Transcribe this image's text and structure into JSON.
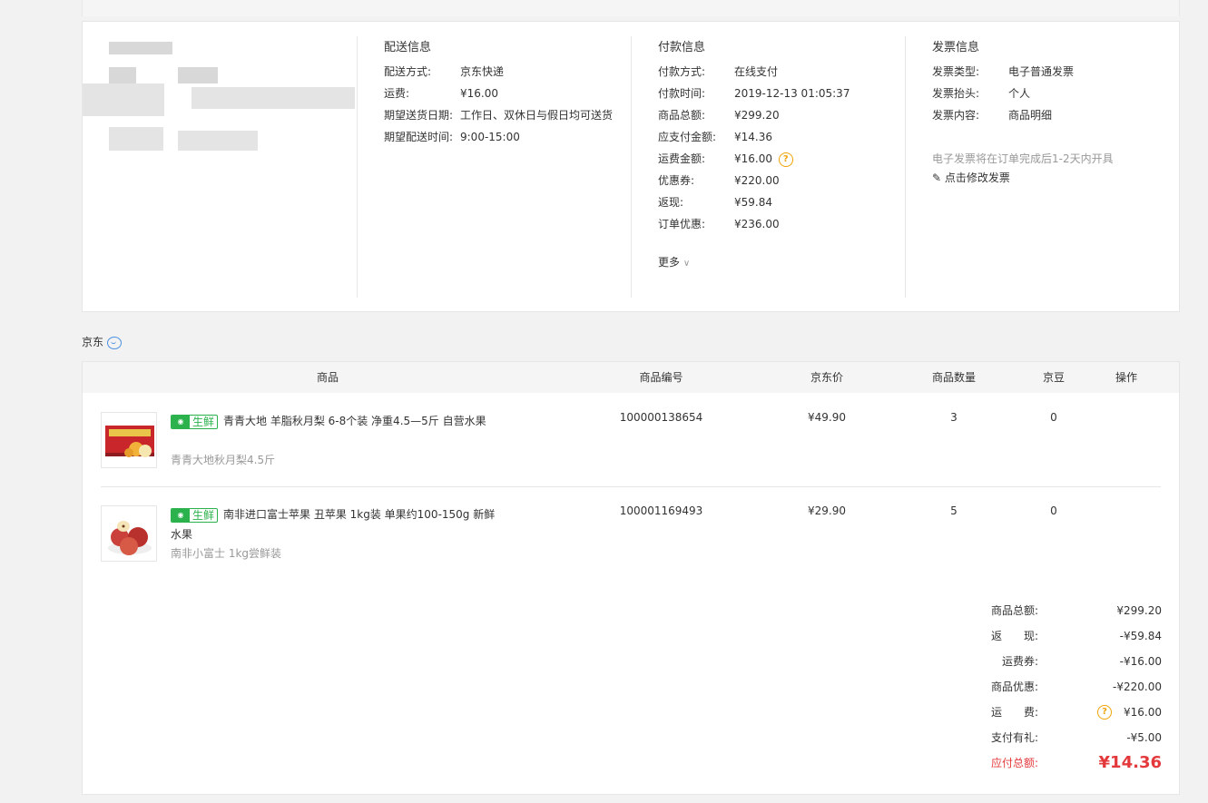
{
  "delivery": {
    "title": "配送信息",
    "rows": [
      {
        "k": "配送方式:",
        "v": "京东快递"
      },
      {
        "k": "运费:",
        "v": "¥16.00"
      },
      {
        "k": "期望送货日期:",
        "v": "工作日、双休日与假日均可送货"
      },
      {
        "k": "期望配送时间:",
        "v": "9:00-15:00"
      }
    ]
  },
  "payment": {
    "title": "付款信息",
    "rows": [
      {
        "k": "付款方式:",
        "v": "在线支付"
      },
      {
        "k": "付款时间:",
        "v": "2019-12-13 01:05:37"
      },
      {
        "k": "商品总额:",
        "v": "¥299.20"
      },
      {
        "k": "应支付金额:",
        "v": "¥14.36"
      },
      {
        "k": "运费金额:",
        "v": "¥16.00"
      },
      {
        "k": "优惠券:",
        "v": "¥220.00"
      },
      {
        "k": "返现:",
        "v": "¥59.84"
      },
      {
        "k": "订单优惠:",
        "v": "¥236.00"
      }
    ],
    "more_label": "更多",
    "help_glyph": "?"
  },
  "invoice": {
    "title": "发票信息",
    "rows": [
      {
        "k": "发票类型:",
        "v": "电子普通发票"
      },
      {
        "k": "发票抬头:",
        "v": "个人"
      },
      {
        "k": "发票内容:",
        "v": "商品明细"
      }
    ],
    "note": "电子发票将在订单完成后1-2天内开具",
    "edit_label": "点击修改发票",
    "edit_icon": "✎"
  },
  "shop": {
    "name": "京东",
    "chat_icon": "chat-bubble-icon"
  },
  "table": {
    "headers": [
      "商品",
      "商品编号",
      "京东价",
      "商品数量",
      "京豆",
      "操作"
    ],
    "fresh_tag_icon": "fresh-icon",
    "fresh_tag_label": "生鲜",
    "products": [
      {
        "name": "青青大地 羊脂秋月梨 6-8个装 净重4.5—5斤 自营水果",
        "sub": "青青大地秋月梨4.5斤",
        "sku": "100000138654",
        "price": "¥49.90",
        "qty": "3",
        "beans": "0"
      },
      {
        "name": "南非进口富士苹果 丑苹果 1kg装 单果约100-150g 新鲜水果",
        "sub": "南非小富士 1kg尝鲜装",
        "sku": "100001169493",
        "price": "¥29.90",
        "qty": "5",
        "beans": "0"
      }
    ]
  },
  "totals": [
    {
      "k": "商品总额:",
      "v": "¥299.20"
    },
    {
      "k": "返　　现:",
      "v": "-¥59.84"
    },
    {
      "k": "运费券:",
      "v": "-¥16.00"
    },
    {
      "k": "商品优惠:",
      "v": "-¥220.00"
    },
    {
      "k": "运　　费:",
      "v": "¥16.00"
    },
    {
      "k": "支付有礼:",
      "v": "-¥5.00"
    },
    {
      "k": "应付总额:",
      "v": "¥14.36"
    }
  ],
  "colors": {
    "accent_red": "#e4393c",
    "fresh_green": "#2bb24c",
    "help_orange": "#f0a30a",
    "link_blue": "#4a90e2"
  }
}
